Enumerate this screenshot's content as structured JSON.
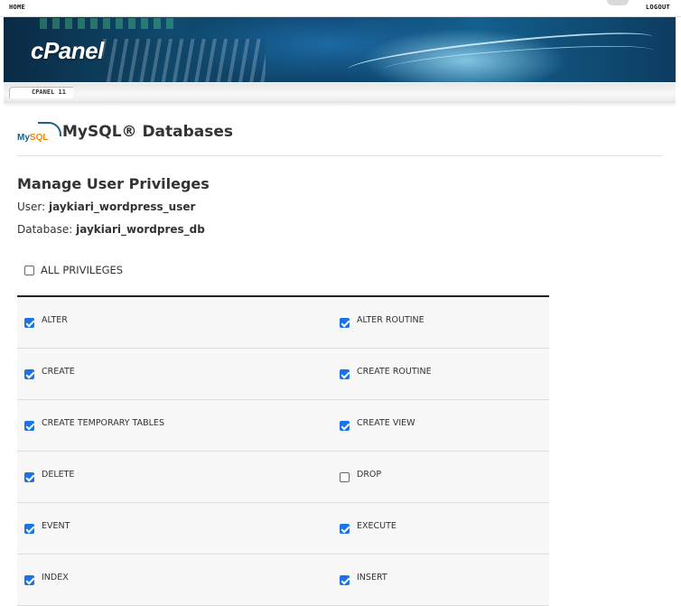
{
  "topbar": {
    "home_label": "HOME",
    "logout_label": "LOGOUT"
  },
  "banner": {
    "logo_text": "cPanel"
  },
  "tabbar": {
    "tab_label": "CPANEL 11"
  },
  "page": {
    "logo_text_a": "My",
    "logo_text_b": "SQL",
    "title": "MySQL® Databases",
    "section_title": "Manage User Privileges",
    "user_label": "User:",
    "user_value": "jaykiari_wordpress_user",
    "db_label": "Database:",
    "db_value": "jaykiari_wordpres_db",
    "all_privileges_label": "ALL PRIVILEGES",
    "all_privileges_checked": false
  },
  "privileges": [
    {
      "left": {
        "label": "ALTER",
        "checked": true
      },
      "right": {
        "label": "ALTER ROUTINE",
        "checked": true
      }
    },
    {
      "left": {
        "label": "CREATE",
        "checked": true
      },
      "right": {
        "label": "CREATE ROUTINE",
        "checked": true
      }
    },
    {
      "left": {
        "label": "CREATE TEMPORARY TABLES",
        "checked": true
      },
      "right": {
        "label": "CREATE VIEW",
        "checked": true
      }
    },
    {
      "left": {
        "label": "DELETE",
        "checked": true
      },
      "right": {
        "label": "DROP",
        "checked": false
      }
    },
    {
      "left": {
        "label": "EVENT",
        "checked": true
      },
      "right": {
        "label": "EXECUTE",
        "checked": true
      }
    },
    {
      "left": {
        "label": "INDEX",
        "checked": true
      },
      "right": {
        "label": "INSERT",
        "checked": true
      }
    }
  ],
  "colors": {
    "checkbox_accent": "#1a73e8",
    "banner_dark": "#0a2a44"
  }
}
